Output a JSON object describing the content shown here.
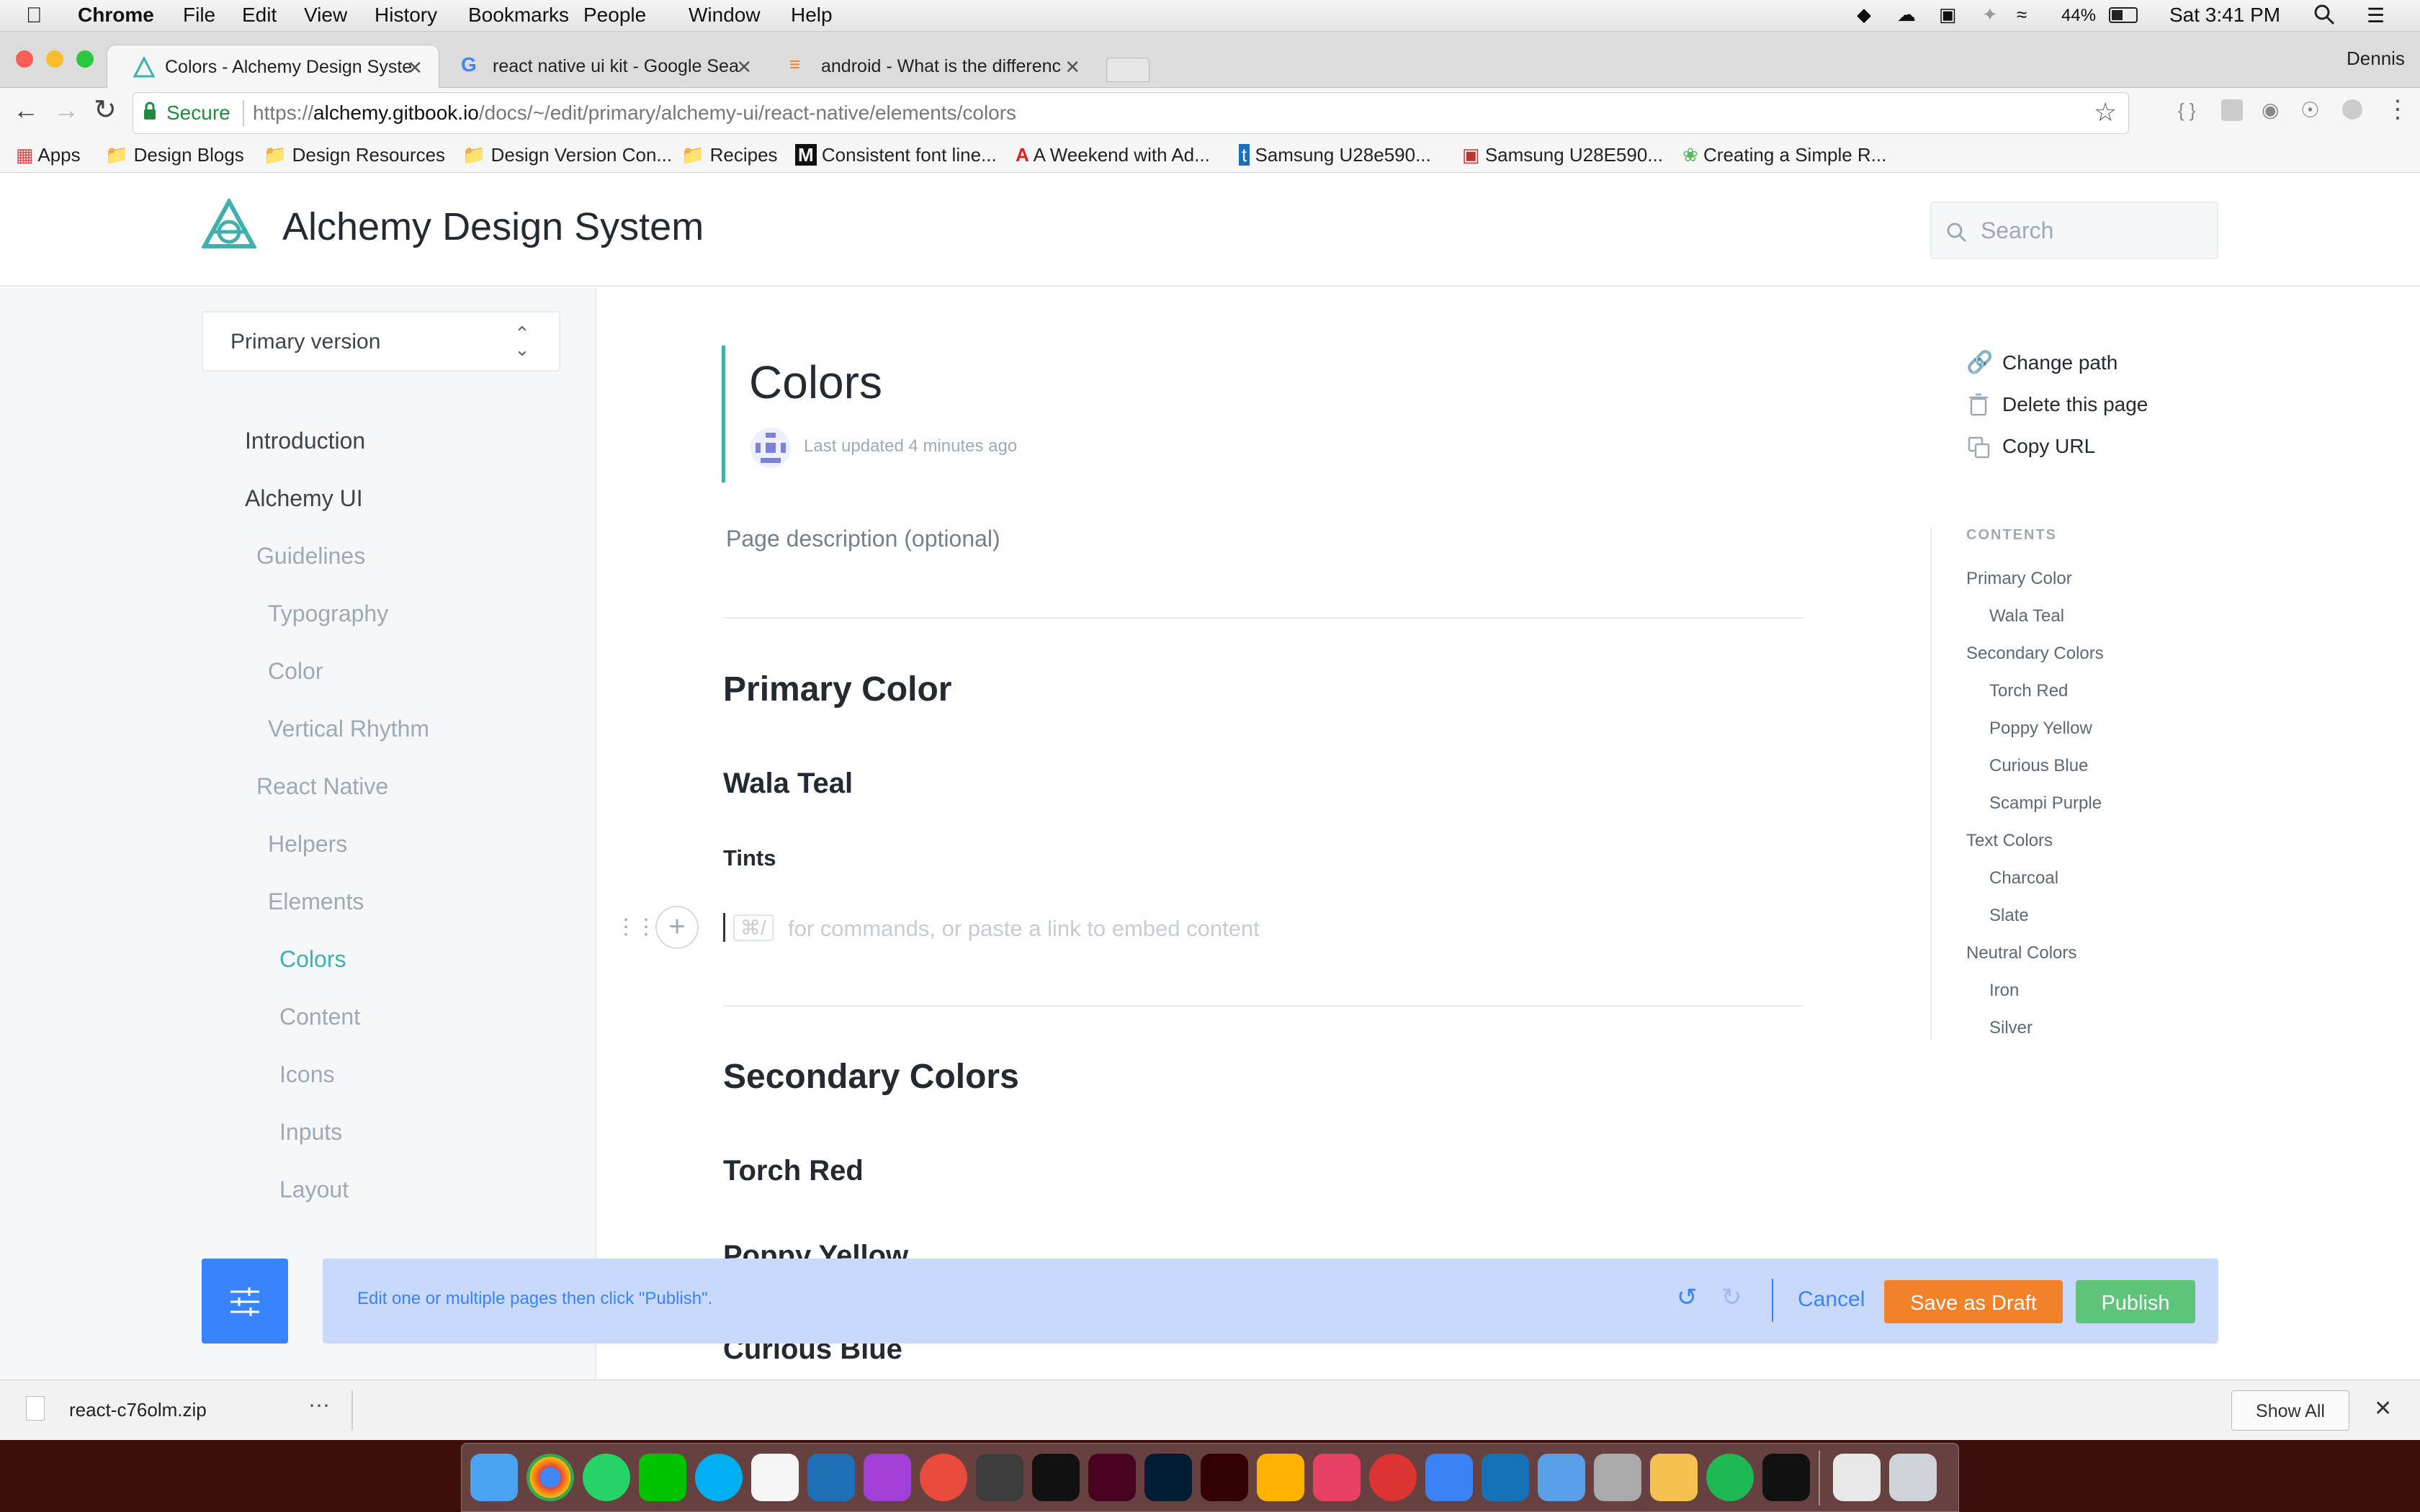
{
  "menubar": {
    "app": "Chrome",
    "items": [
      "File",
      "Edit",
      "View",
      "History",
      "Bookmarks",
      "People",
      "Window",
      "Help"
    ],
    "battery": "44%",
    "clock": "Sat 3:41 PM"
  },
  "tabs": [
    {
      "title": "Colors - Alchemy Design Syste"
    },
    {
      "title": "react native ui kit - Google Sea"
    },
    {
      "title": "android - What is the differenc"
    }
  ],
  "profile": "Dennis",
  "omnibox": {
    "secure": "Secure",
    "url_prefix": "https://",
    "url_host": "alchemy.gitbook.io",
    "url_path": "/docs/~/edit/primary/alchemy-ui/react-native/elements/colors"
  },
  "bookmarks": [
    "Apps",
    "Design Blogs",
    "Design Resources",
    "Design Version Con...",
    "Recipes",
    "Consistent font line...",
    "A Weekend with Ad...",
    "Samsung U28e590...",
    "Samsung U28E590...",
    "Creating a Simple R..."
  ],
  "site": {
    "title": "Alchemy Design System",
    "search_placeholder": "Search"
  },
  "sidebar": {
    "version": "Primary version",
    "nav": [
      "Introduction",
      "Alchemy UI",
      "Guidelines",
      "Typography",
      "Color",
      "Vertical Rhythm",
      "React Native",
      "Helpers",
      "Elements",
      "Colors",
      "Content",
      "Icons",
      "Inputs",
      "Layout"
    ]
  },
  "page": {
    "title": "Colors",
    "updated": "Last updated 4 minutes ago",
    "description": "Page description (optional)",
    "h_primary": "Primary Color",
    "h_wala": "Wala Teal",
    "h_tints": "Tints",
    "shortcut": "⌘/",
    "editor_placeholder": "for commands, or paste a link to embed content",
    "h_secondary": "Secondary Colors",
    "h_torch": "Torch Red",
    "h_poppy": "Poppy Yellow",
    "h_curious": "Curious Blue"
  },
  "actions": {
    "change_path": "Change path",
    "delete": "Delete this page",
    "copy_url": "Copy URL"
  },
  "toc": {
    "heading": "CONTENTS",
    "items": [
      "Primary Color",
      "Wala Teal",
      "Secondary Colors",
      "Torch Red",
      "Poppy Yellow",
      "Curious Blue",
      "Scampi Purple",
      "Text Colors",
      "Charcoal",
      "Slate",
      "Neutral Colors",
      "Iron",
      "Silver"
    ]
  },
  "publish": {
    "message": "Edit one or multiple pages then click \"Publish\".",
    "cancel": "Cancel",
    "draft": "Save as Draft",
    "publish": "Publish"
  },
  "download": {
    "filename": "react-c76olm.zip",
    "show_all": "Show All"
  },
  "colors": {
    "teal": "#3fb0ac",
    "blue": "#3884ff",
    "orange": "#f1822a",
    "green": "#5ec47a"
  }
}
